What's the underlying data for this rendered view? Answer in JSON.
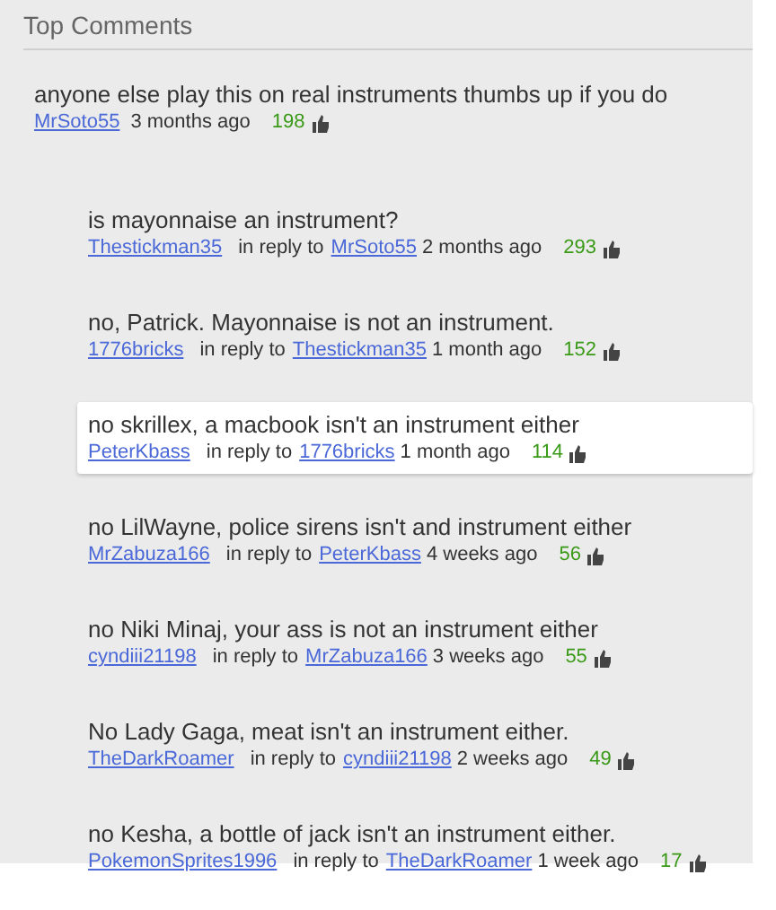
{
  "section_title": "Top Comments",
  "comments": [
    {
      "text": "anyone else play this on real instruments thumbs up if you do",
      "author": "MrSoto55",
      "time": "3 months ago",
      "likes": "198",
      "highlighted": false,
      "children": [
        {
          "text": "is mayonnaise an instrument?",
          "author": "Thestickman35",
          "reply_prefix": "in reply to",
          "reply_to": "MrSoto55",
          "time": "2 months ago",
          "likes": "293",
          "highlighted": false
        },
        {
          "text": "no, Patrick. Mayonnaise is not an instrument.",
          "author": "1776bricks",
          "reply_prefix": "in reply to",
          "reply_to": "Thestickman35",
          "time": "1 month ago",
          "likes": "152",
          "highlighted": false
        },
        {
          "text": "no skrillex, a macbook isn't an instrument either",
          "author": "PeterKbass",
          "reply_prefix": "in reply to",
          "reply_to": "1776bricks",
          "time": "1 month ago",
          "likes": "114",
          "highlighted": true
        },
        {
          "text": "no LilWayne, police sirens isn't and instrument either",
          "author": "MrZabuza166",
          "reply_prefix": "in reply to",
          "reply_to": "PeterKbass",
          "time": "4 weeks ago",
          "likes": "56",
          "highlighted": false
        },
        {
          "text": "no Niki Minaj, your ass is not an instrument either",
          "author": "cyndiii21198",
          "reply_prefix": "in reply to",
          "reply_to": "MrZabuza166",
          "time": "3 weeks ago",
          "likes": "55",
          "highlighted": false
        },
        {
          "text": "No Lady Gaga, meat isn't an instrument either.",
          "author": "TheDarkRoamer",
          "reply_prefix": "in reply to",
          "reply_to": "cyndiii21198",
          "time": "2 weeks ago",
          "likes": "49",
          "highlighted": false
        },
        {
          "text": "no Kesha, a bottle of jack isn't an instrument either.",
          "author": "PokemonSprites1996",
          "reply_prefix": "in reply to",
          "reply_to": "TheDarkRoamer",
          "time": "1 week ago",
          "likes": "17",
          "highlighted": false
        }
      ]
    }
  ]
}
